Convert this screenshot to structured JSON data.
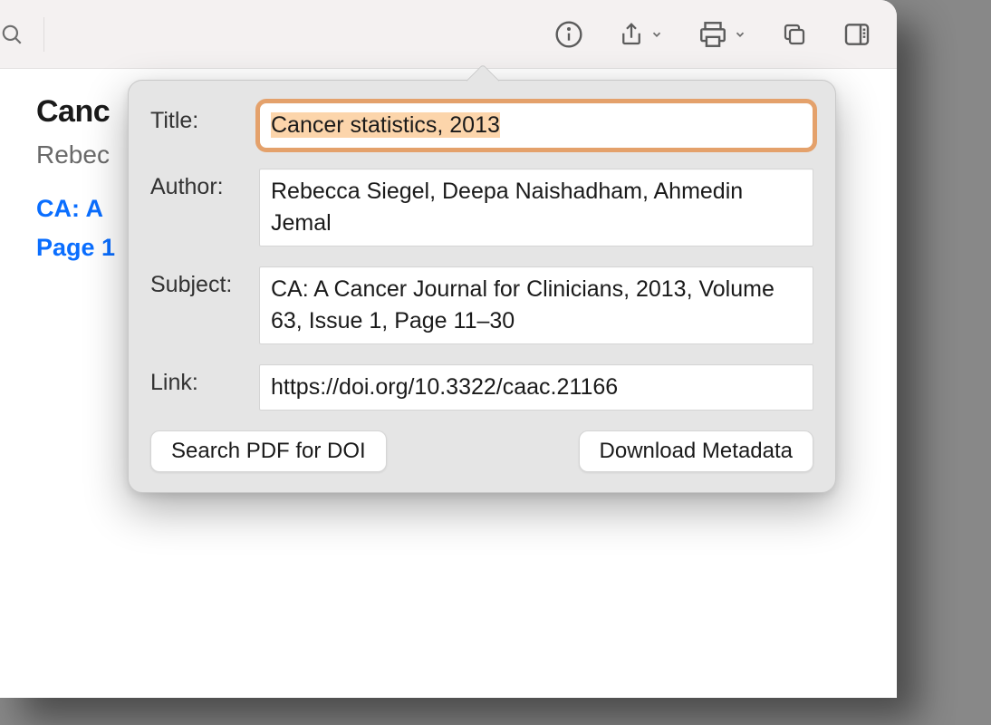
{
  "toolbar": {
    "icons": {
      "search": "search-icon",
      "info": "info-icon",
      "share": "share-icon",
      "print": "print-icon",
      "copy": "copy-icon",
      "sidebar": "sidebar-icon"
    }
  },
  "document": {
    "title_visible": "Canc",
    "author_visible": "Rebec",
    "journal_line1_visible": "CA: A",
    "journal_line2_visible": "Page 1"
  },
  "popover": {
    "labels": {
      "title": "Title:",
      "author": "Author:",
      "subject": "Subject:",
      "link": "Link:"
    },
    "fields": {
      "title": "Cancer statistics, 2013",
      "author": "Rebecca Siegel, Deepa Naishadham, Ahmedin Jemal",
      "subject": "CA: A Cancer Journal for Clinicians, 2013, Volume 63, Issue 1, Page 11–30",
      "link": "https://doi.org/10.3322/caac.21166"
    },
    "buttons": {
      "search_doi": "Search PDF for DOI",
      "download_meta": "Download Metadata"
    }
  }
}
